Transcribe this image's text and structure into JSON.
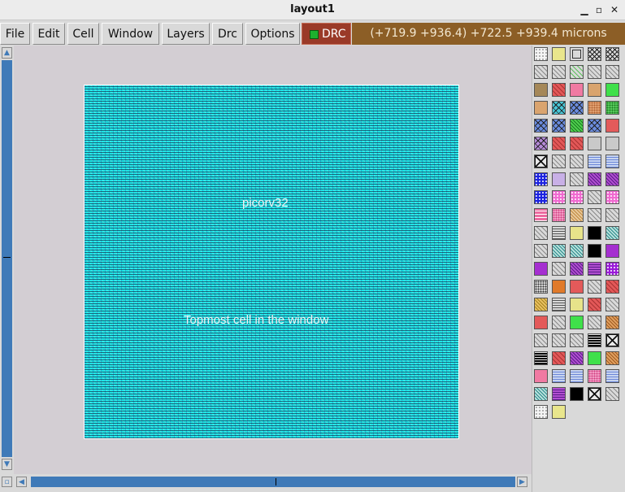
{
  "window": {
    "title": "layout1"
  },
  "menu": [
    "File",
    "Edit",
    "Cell",
    "Window",
    "Layers",
    "Drc",
    "Options"
  ],
  "drc": {
    "label": "DRC",
    "status_color": "#1db12e"
  },
  "coords": "(+719.9 +936.4) +722.5 +939.4 microns",
  "layout": {
    "cell_name": "picorv32",
    "cell_caption": "Topmost cell in the window",
    "fill_color": "#1ee6e6"
  },
  "palette": {
    "swatches": [
      [
        "dots-white",
        "yellow-solid",
        "gray-box",
        "cross-hatch",
        "cross-hatch"
      ],
      [
        "diag-gray",
        "diag-gray",
        "diag-green",
        "diag-gray",
        "diag-gray"
      ],
      [
        "brown-solid",
        "red-hatch",
        "pink-solid",
        "tan-solid",
        "green-solid"
      ],
      [
        "tan-solid",
        "cyan-x",
        "blue-x",
        "dots-tan",
        "green-dots"
      ],
      [
        "blue-x",
        "blue-x",
        "green-hatch",
        "blue-x",
        "red-solid"
      ],
      [
        "purple-x",
        "red-hatch",
        "red-hatch",
        "gray-solid",
        "gray-solid"
      ],
      [
        "black-x",
        "diag-gray",
        "diag-gray",
        "blue-wave",
        "blue-wave"
      ],
      [
        "blue-triangles",
        "lavender-solid",
        "diag-gray",
        "purple-hatch",
        "purple-hatch"
      ],
      [
        "blue-triangles",
        "pink-diamond",
        "pink-diamond",
        "diag-gray",
        "pink-diamond"
      ],
      [
        "pink-brick",
        "pink-dots",
        "tan-wave",
        "diag-gray",
        "diag-gray"
      ],
      [
        "diag-gray",
        "gray-stripes",
        "yellow-box",
        "black-solid",
        "teal-hatch"
      ],
      [
        "diag-gray",
        "teal-hatch",
        "teal-hatch",
        "black-solid",
        "purple-solid"
      ],
      [
        "purple-solid",
        "diag-gray",
        "purple-hatch",
        "purple-stripes",
        "purple-dots"
      ],
      [
        "gray-dots",
        "orange-solid",
        "red-solid",
        "diag-gray",
        "red-hatch"
      ],
      [
        "yellow-hatch",
        "gray-stripes",
        "yellow-box",
        "red-hatch",
        "diag-gray"
      ],
      [
        "red-solid",
        "diag-gray",
        "green-solid",
        "diag-gray",
        "tan-hatch"
      ],
      [
        "diag-gray",
        "diag-gray",
        "diag-gray",
        "black-stripes",
        "black-x"
      ],
      [
        "black-stripes",
        "red-hatch",
        "purple-hatch",
        "green-solid",
        "tan-hatch"
      ],
      [
        "pink-solid",
        "blue-wave",
        "blue-wave",
        "pink-dots",
        "blue-wave"
      ],
      [
        "teal-hatch",
        "purple-stripes",
        "black-solid",
        "black-x",
        "diag-gray"
      ],
      [
        "dots-white",
        "yellow-solid"
      ]
    ]
  }
}
